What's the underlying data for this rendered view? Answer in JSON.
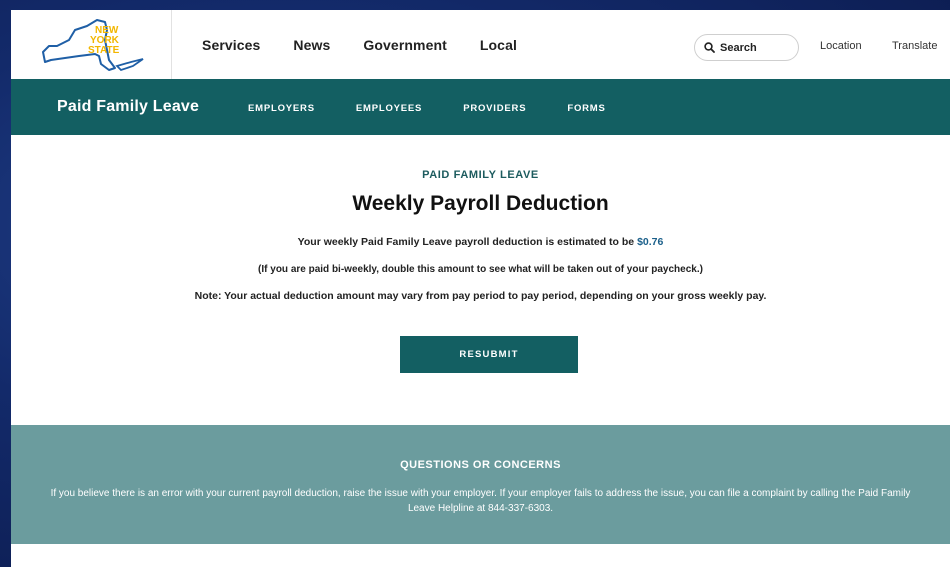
{
  "header": {
    "logo_text": "NEW YORK STATE",
    "logo_colors": {
      "state": "#1f5fa6",
      "text": "#f2b600"
    },
    "nav": [
      "Services",
      "News",
      "Government",
      "Local"
    ],
    "search_label": "Search",
    "location": "Location",
    "translate": "Translate"
  },
  "subnav": {
    "brand": "Paid Family Leave",
    "links": [
      "EMPLOYERS",
      "EMPLOYEES",
      "PROVIDERS",
      "FORMS"
    ],
    "color": "#135f62"
  },
  "main": {
    "eyebrow": "PAID FAMILY LEAVE",
    "title": "Weekly Payroll Deduction",
    "estimate_prefix": "Your weekly Paid Family Leave payroll deduction is estimated to be ",
    "estimate_amount": "$0.76",
    "biweekly_note": "(If you are paid bi-weekly, double this amount to see what will be taken out of your paycheck.)",
    "variance_note": "Note: Your actual deduction amount may vary from pay period to pay period, depending on your gross weekly pay.",
    "resubmit_label": "RESUBMIT"
  },
  "questions": {
    "title": "QUESTIONS OR CONCERNS",
    "body": "If you believe there is an error with your current payroll deduction, raise the issue with your employer. If your employer fails to address the issue, you can file a complaint by calling the Paid Family Leave Helpline at 844-337-6303.",
    "background": "#6b9c9e"
  }
}
